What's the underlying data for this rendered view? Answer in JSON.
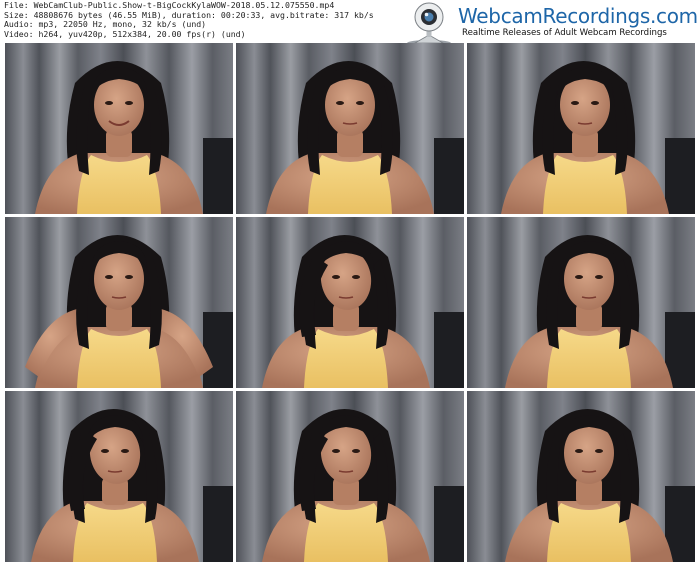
{
  "file_info": {
    "file": "File: WebCamClub-Public.Show-t-BigCockKylaWOW-2018.05.12.075550.mp4",
    "size": "Size: 48808676 bytes (46.55 MiB), duration: 00:20:33, avg.bitrate: 317 kb/s",
    "audio": "Audio: mp3, 22050 Hz, mono, 32 kb/s (und)",
    "video": "Video: h264, yuv420p, 512x384, 20.00 fps(r) (und)"
  },
  "brand": {
    "name": "WebcamRecordings.com",
    "tagline": "Realtime Releases of Adult Webcam Recordings",
    "logo_icon": "webcam-icon",
    "name_color": "#1e66a8"
  },
  "thumbnails": [
    {
      "id": "thumb-1",
      "pose": "smile"
    },
    {
      "id": "thumb-2",
      "pose": "neutral"
    },
    {
      "id": "thumb-3",
      "pose": "close"
    },
    {
      "id": "thumb-4",
      "pose": "arms-up"
    },
    {
      "id": "thumb-5",
      "pose": "hair-flip"
    },
    {
      "id": "thumb-6",
      "pose": "lean"
    },
    {
      "id": "thumb-7",
      "pose": "hair-flip"
    },
    {
      "id": "thumb-8",
      "pose": "hair-flip"
    },
    {
      "id": "thumb-9",
      "pose": "lean"
    }
  ],
  "colors": {
    "background": "#ffffff",
    "curtain": "#6a6e76",
    "top": "#f2cf73",
    "hair": "#161314",
    "skin": "#c08a6c"
  }
}
